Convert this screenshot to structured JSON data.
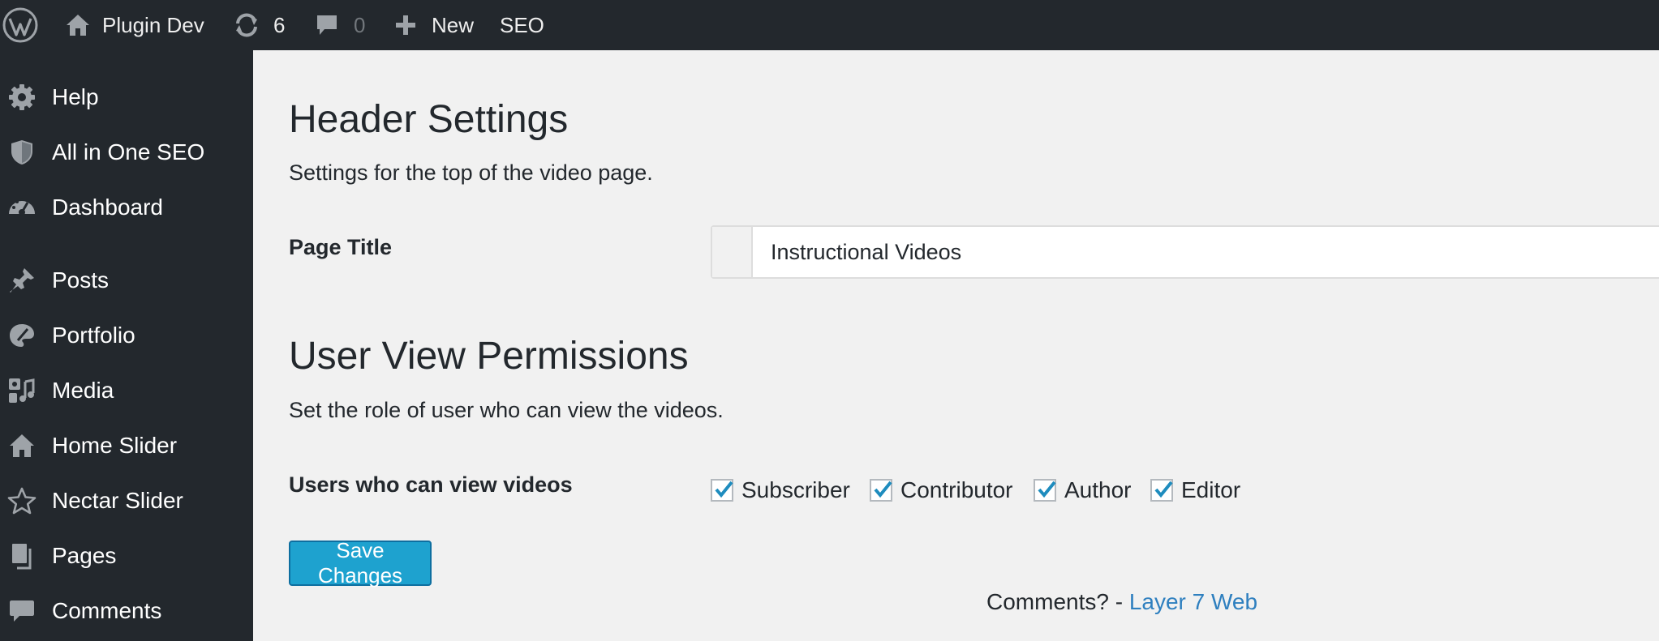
{
  "adminbar": {
    "site_name": "Plugin Dev",
    "updates_count": "6",
    "comments_count": "0",
    "new_label": "New",
    "seo_label": "SEO"
  },
  "sidebar": {
    "items": [
      {
        "label": "Help",
        "icon": "gear-icon"
      },
      {
        "label": "All in One SEO",
        "icon": "shield-icon"
      },
      {
        "label": "Dashboard",
        "icon": "dashboard-icon"
      },
      {
        "label": "Posts",
        "icon": "pin-icon"
      },
      {
        "label": "Portfolio",
        "icon": "palette-icon"
      },
      {
        "label": "Media",
        "icon": "media-icon"
      },
      {
        "label": "Home Slider",
        "icon": "home-icon"
      },
      {
        "label": "Nectar Slider",
        "icon": "star-icon"
      },
      {
        "label": "Pages",
        "icon": "pages-icon"
      },
      {
        "label": "Comments",
        "icon": "comment-icon"
      }
    ]
  },
  "main": {
    "header_settings": {
      "heading": "Header Settings",
      "description": "Settings for the top of the video page.",
      "page_title_label": "Page Title",
      "page_title_value": "Instructional Videos"
    },
    "permissions": {
      "heading": "User View Permissions",
      "description": "Set the role of user who can view the videos.",
      "field_label": "Users who can view videos",
      "roles": [
        {
          "label": "Subscriber",
          "checked": true
        },
        {
          "label": "Contributor",
          "checked": true
        },
        {
          "label": "Author",
          "checked": true
        },
        {
          "label": "Editor",
          "checked": true
        }
      ]
    },
    "save_label": "Save Changes",
    "footer": {
      "prefix": "Comments? - ",
      "link_text": "Layer 7 Web"
    }
  },
  "colors": {
    "adminbar_bg": "#23282d",
    "content_bg": "#f1f1f1",
    "primary_button": "#1ea2cf",
    "link": "#2e7fbf",
    "checkmark": "#1e8cbe"
  }
}
